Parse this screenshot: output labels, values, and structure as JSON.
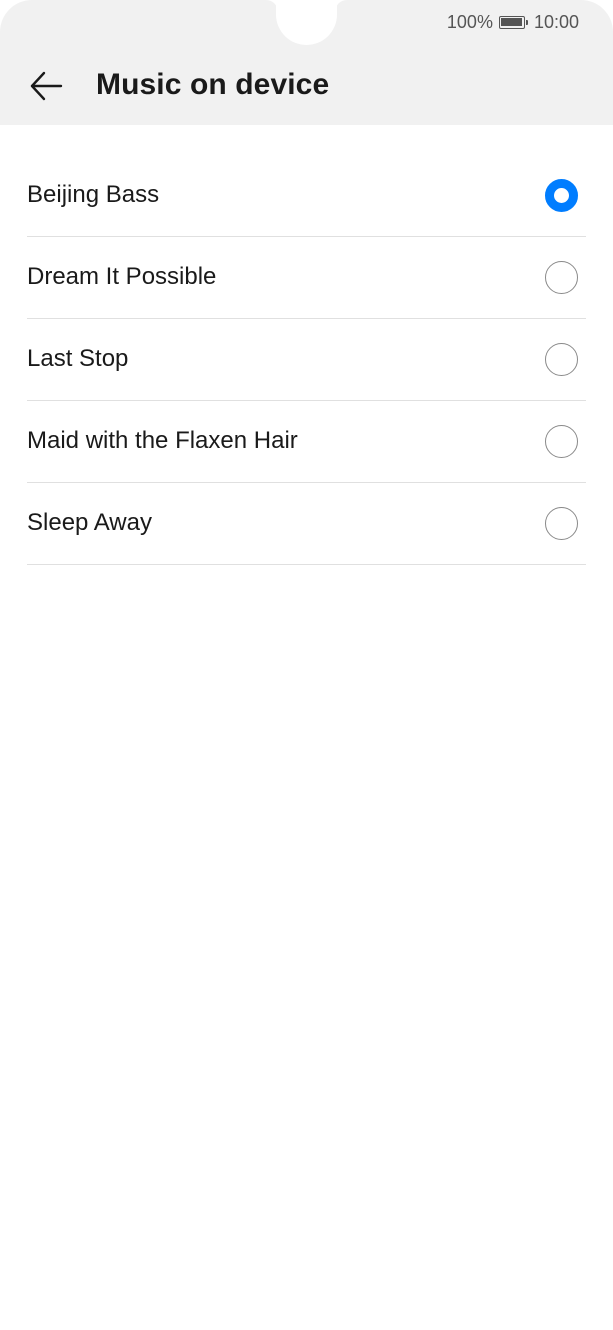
{
  "status_bar": {
    "battery_percent": "100%",
    "time": "10:00"
  },
  "header": {
    "title": "Music on device",
    "back_icon": "arrow-left-icon"
  },
  "colors": {
    "accent": "#007dff",
    "header_bg": "#f1f1f1",
    "divider": "#e0e0e0"
  },
  "songs": [
    {
      "label": "Beijing Bass",
      "selected": true
    },
    {
      "label": "Dream It Possible",
      "selected": false
    },
    {
      "label": "Last Stop",
      "selected": false
    },
    {
      "label": "Maid with the Flaxen Hair",
      "selected": false
    },
    {
      "label": "Sleep Away",
      "selected": false
    }
  ]
}
